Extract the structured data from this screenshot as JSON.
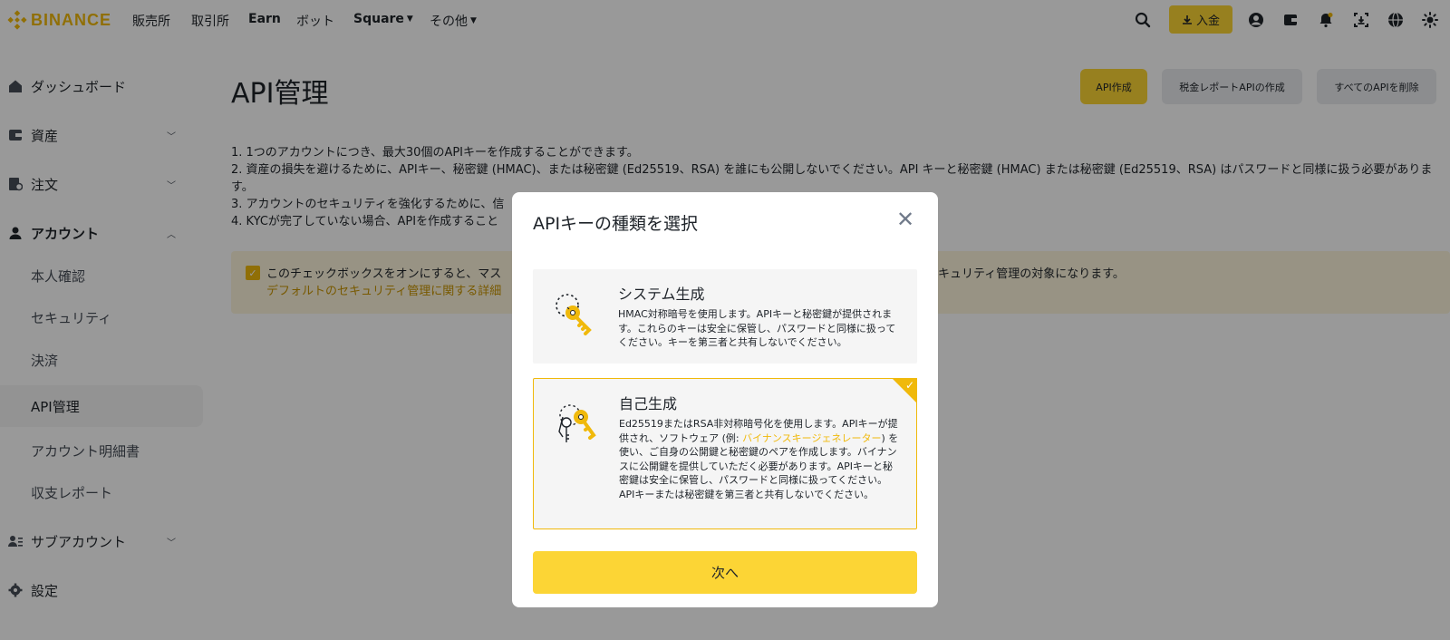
{
  "nav": {
    "logo_text": "BINANCE",
    "items": [
      "販売所",
      "取引所",
      "Earn",
      "ボット",
      "Square",
      "その他"
    ],
    "deposit_label": "入金",
    "icons": [
      "search-icon",
      "user-icon",
      "wallet-icon",
      "bell-icon",
      "download-app-icon",
      "globe-icon",
      "theme-icon"
    ]
  },
  "sidebar": {
    "items": [
      {
        "label": "ダッシュボード",
        "icon": "dashboard-icon"
      },
      {
        "label": "資産",
        "icon": "wallet-icon",
        "expand": "down"
      },
      {
        "label": "注文",
        "icon": "orders-icon",
        "expand": "down"
      },
      {
        "label": "アカウント",
        "icon": "person-icon",
        "expand": "up"
      },
      {
        "label": "本人確認"
      },
      {
        "label": "セキュリティ"
      },
      {
        "label": "決済"
      },
      {
        "label": "API管理"
      },
      {
        "label": "アカウント明細書"
      },
      {
        "label": "収支レポート"
      },
      {
        "label": "サブアカウント",
        "icon": "subaccount-icon",
        "expand": "down"
      },
      {
        "label": "設定",
        "icon": "gear-icon"
      }
    ]
  },
  "main": {
    "title": "API管理",
    "buttons": {
      "create": "API作成",
      "tax": "税金レポートAPIの作成",
      "delete_all": "すべてのAPIを削除"
    },
    "notes": [
      "1. 1つのアカウントにつき、最大30個のAPIキーを作成することができます。",
      "2. 資産の損失を避けるために、APIキー、秘密鍵 (HMAC)、または秘密鍵 (Ed25519、RSA) を誰にも公開しないでください。API キーと秘密鍵 (HMAC) または秘密鍵 (Ed25519、RSA) はパスワードと同様に扱う必要があります。",
      "3. アカウントのセキュリティを強化するために、信",
      "4. KYCが完了していない場合、APIを作成すること"
    ],
    "notice": {
      "text": "このチェックボックスをオンにすると、マス",
      "link": "デフォルトのセキュリティ管理に関する詳細",
      "right_text": "キュリティ管理の対象になります。"
    }
  },
  "modal": {
    "title": "APIキーの種類を選択",
    "options": [
      {
        "title": "システム生成",
        "desc": "HMAC対称暗号を使用します。APIキーと秘密鍵が提供されます。これらのキーは安全に保管し、パスワードと同様に扱ってください。キーを第三者と共有しないでください。"
      },
      {
        "title": "自己生成",
        "desc_before": "Ed25519またはRSA非対称暗号化を使用します。APIキーが提供され、ソフトウェア (例: ",
        "desc_link": "バイナンスキージェネレーター",
        "desc_after": ") を使い、ご自身の公開鍵と秘密鍵のペアを作成します。バイナンスに公開鍵を提供していただく必要があります。APIキーと秘密鍵は安全に保管し、パスワードと同様に扱ってください。APIキーまたは秘密鍵を第三者と共有しないでください。",
        "selected": true
      }
    ],
    "next_label": "次へ"
  },
  "colors": {
    "brand": "#f0b90b",
    "button_yellow": "#fcd535",
    "overlay": "rgba(0,0,0,0.40)"
  }
}
